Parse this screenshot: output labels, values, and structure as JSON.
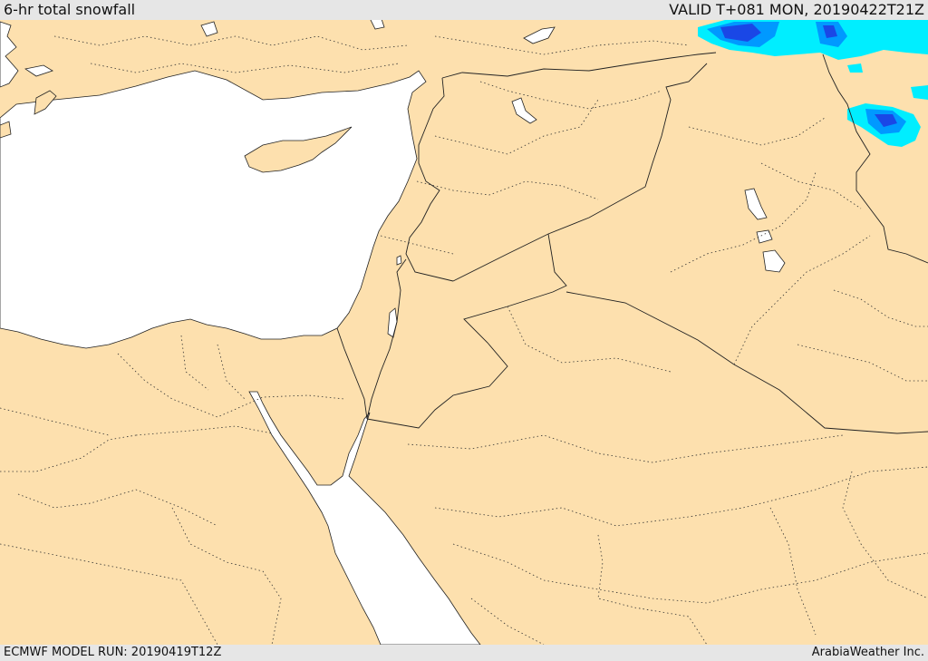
{
  "header": {
    "title": "6-hr total snowfall",
    "valid": "VALID T+081 MON, 20190422T21Z"
  },
  "footer": {
    "model_run": "ECMWF MODEL RUN: 20190419T12Z",
    "credit": "ArabiaWeather Inc."
  },
  "colors": {
    "land": "#fde0ae",
    "water": "#ffffff",
    "border": "#222222",
    "snow_light": "#00eeff",
    "snow_medium": "#0099ff",
    "snow_heavy": "#1a47e6",
    "bar": "#e6e6e6"
  }
}
